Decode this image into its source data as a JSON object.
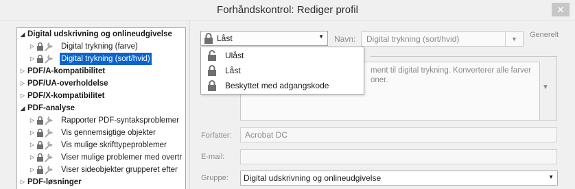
{
  "window": {
    "title": "Forhåndskontrol: Rediger profil",
    "close_glyph": "✕"
  },
  "tree": {
    "items": [
      {
        "label": "Digital udskrivning og onlineudgivelse",
        "bold": true,
        "level": 0,
        "expanded": true
      },
      {
        "label": "Digital trykning (farve)",
        "bold": false,
        "level": 1,
        "icon": "lock-wrench-icon"
      },
      {
        "label": "Digital trykning (sort/hvid)",
        "bold": false,
        "level": 1,
        "icon": "lock-wrench-icon",
        "selected": true
      },
      {
        "label": "PDF/A-kompatibilitet",
        "bold": true,
        "level": 0,
        "expanded": false
      },
      {
        "label": "PDF/UA-overholdelse",
        "bold": true,
        "level": 0,
        "expanded": false
      },
      {
        "label": "PDF/X-kompatibilitet",
        "bold": true,
        "level": 0,
        "expanded": false
      },
      {
        "label": "PDF-analyse",
        "bold": true,
        "level": 0,
        "expanded": true
      },
      {
        "label": "Rapporter PDF-syntaksproblemer",
        "bold": false,
        "level": 1,
        "icon": "lock-wrench-icon"
      },
      {
        "label": "Vis gennemsigtige objekter",
        "bold": false,
        "level": 1,
        "icon": "lock-wrench-icon"
      },
      {
        "label": "Vis mulige skrifttypeproblemer",
        "bold": false,
        "level": 1,
        "icon": "lock-wrench-icon"
      },
      {
        "label": "Viser mulige problemer med overtr",
        "bold": false,
        "level": 1,
        "icon": "lock-wrench-icon"
      },
      {
        "label": "Viser sideobjekter grupperet efter",
        "bold": false,
        "level": 1,
        "icon": "lock-wrench-icon"
      },
      {
        "label": "PDF-løsninger",
        "bold": true,
        "level": 0,
        "expanded": false
      }
    ]
  },
  "lock": {
    "selected": "Låst",
    "options": [
      "Ulåst",
      "Låst",
      "Beskyttet med adgangskode"
    ],
    "option_icons": [
      "unlock-icon",
      "lock-icon",
      "lock-icon"
    ]
  },
  "name_field": {
    "label": "Navn:",
    "value": "Digital trykning (sort/hvid)"
  },
  "general_label": "Generelt",
  "description": {
    "line1": "ment til digital trykning. Konverterer alle farver",
    "line2": "oner."
  },
  "author": {
    "label": "Forfatter:",
    "value": "Acrobat DC"
  },
  "email": {
    "label": "E-mail:",
    "value": ""
  },
  "group": {
    "label": "Gruppe:",
    "value": "Digital udskrivning og onlineudgivelse"
  },
  "colors": {
    "selection": "#0a64cc",
    "lock_icon": "#6f6f6f",
    "wrench_icon": "#a6a6a6"
  }
}
